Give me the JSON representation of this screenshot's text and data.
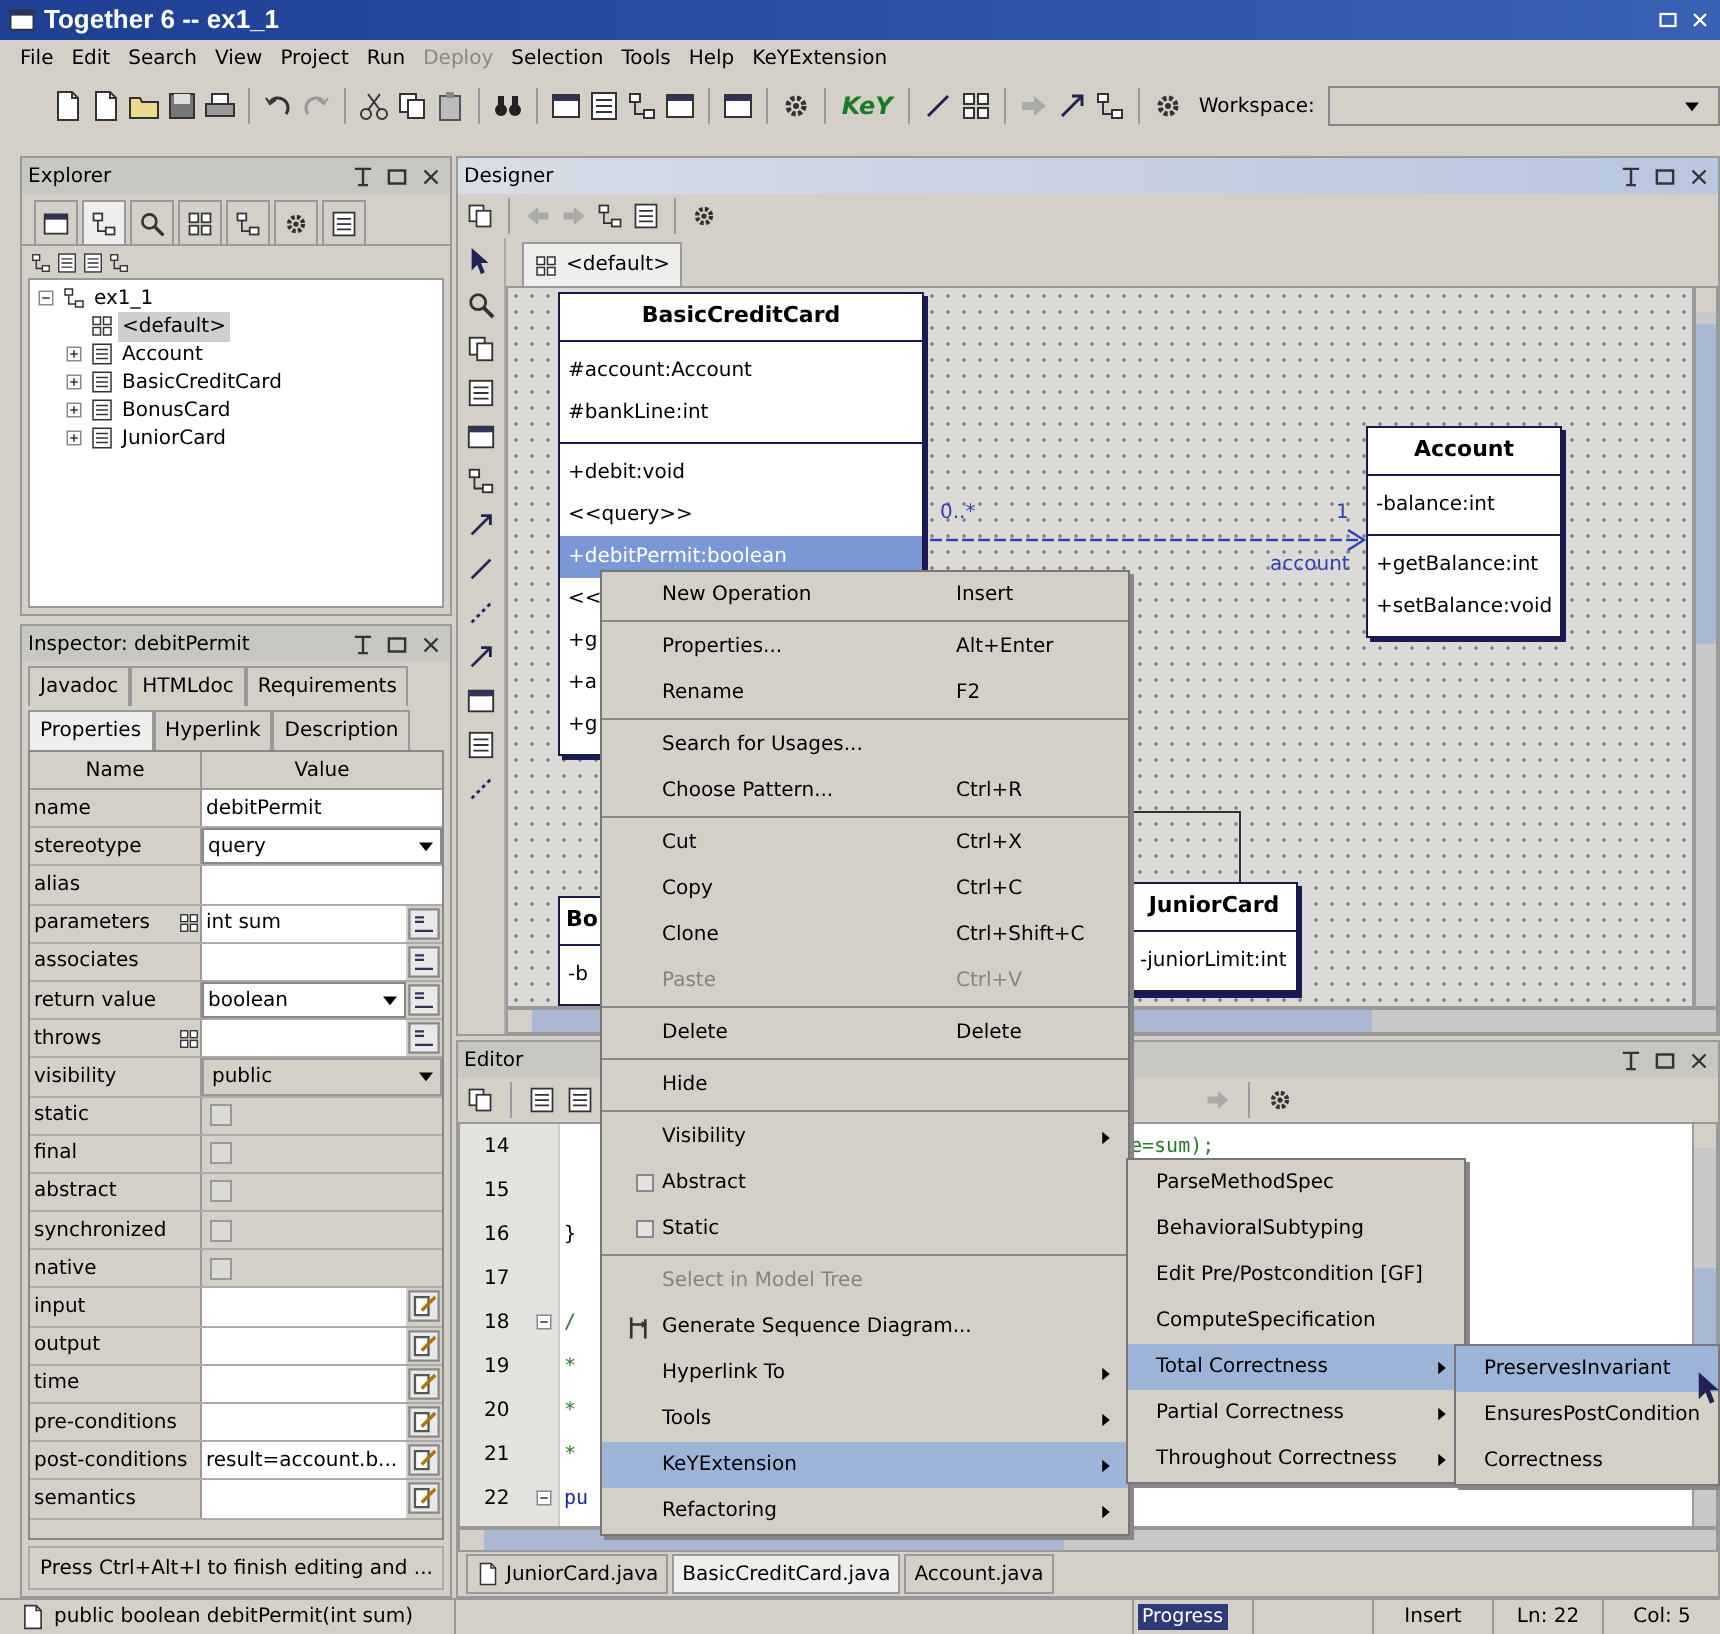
{
  "window": {
    "title": "Together 6 -- ex1_1"
  },
  "menu_bar": [
    {
      "label": "File",
      "disabled": false
    },
    {
      "label": "Edit",
      "disabled": false
    },
    {
      "label": "Search",
      "disabled": false
    },
    {
      "label": "View",
      "disabled": false
    },
    {
      "label": "Project",
      "disabled": false
    },
    {
      "label": "Run",
      "disabled": false
    },
    {
      "label": "Deploy",
      "disabled": true
    },
    {
      "label": "Selection",
      "disabled": false
    },
    {
      "label": "Tools",
      "disabled": false
    },
    {
      "label": "Help",
      "disabled": false
    },
    {
      "label": "KeYExtension",
      "disabled": false
    }
  ],
  "toolbar": {
    "key_logo": "KeY",
    "workspace_label": "Workspace:"
  },
  "explorer": {
    "title": "Explorer",
    "tabs": [
      {
        "selected": false
      },
      {
        "selected": true
      },
      {
        "selected": false
      },
      {
        "selected": false
      },
      {
        "selected": false
      },
      {
        "selected": false
      },
      {
        "selected": false
      }
    ],
    "tree": [
      {
        "label": "ex1_1",
        "kind": "project",
        "expanded": true,
        "selected": false,
        "children": [
          {
            "label": "<default>",
            "kind": "package",
            "selected": true
          },
          {
            "label": "Account",
            "kind": "class",
            "expanded": false,
            "selected": false
          },
          {
            "label": "BasicCreditCard",
            "kind": "class",
            "expanded": false,
            "selected": false
          },
          {
            "label": "BonusCard",
            "kind": "class",
            "expanded": false,
            "selected": false
          },
          {
            "label": "JuniorCard",
            "kind": "class",
            "expanded": false,
            "selected": false
          }
        ]
      }
    ]
  },
  "inspector": {
    "title": "Inspector: debitPermit",
    "tab_rows": [
      [
        {
          "label": "Javadoc",
          "selected": false
        },
        {
          "label": "HTMLdoc",
          "selected": false
        },
        {
          "label": "Requirements",
          "selected": false
        }
      ],
      [
        {
          "label": "Properties",
          "selected": true
        },
        {
          "label": "Hyperlink",
          "selected": false
        },
        {
          "label": "Description",
          "selected": false
        }
      ]
    ],
    "columns": [
      "Name",
      "Value"
    ],
    "rows": [
      {
        "name": "name",
        "kind": "text",
        "value": "debitPermit"
      },
      {
        "name": "stereotype",
        "kind": "combo",
        "value": "query"
      },
      {
        "name": "alias",
        "kind": "text"
      },
      {
        "name": "parameters",
        "kind": "list",
        "value": "int sum"
      },
      {
        "name": "associates",
        "kind": "browse"
      },
      {
        "name": "return value",
        "kind": "combo-browse",
        "value": "boolean"
      },
      {
        "name": "throws",
        "kind": "list"
      },
      {
        "name": "visibility",
        "kind": "select",
        "value": "public"
      },
      {
        "name": "static",
        "kind": "checkbox",
        "checked": false
      },
      {
        "name": "final",
        "kind": "checkbox",
        "checked": false
      },
      {
        "name": "abstract",
        "kind": "checkbox",
        "checked": false
      },
      {
        "name": "synchronized",
        "kind": "checkbox",
        "checked": false
      },
      {
        "name": "native",
        "kind": "checkbox",
        "checked": false
      },
      {
        "name": "input",
        "kind": "memo"
      },
      {
        "name": "output",
        "kind": "memo"
      },
      {
        "name": "time",
        "kind": "memo"
      },
      {
        "name": "pre-conditions",
        "kind": "memo"
      },
      {
        "name": "post-conditions",
        "kind": "memo",
        "value": "result=account.b..."
      },
      {
        "name": "semantics",
        "kind": "memo"
      }
    ],
    "hint": "Press Ctrl+Alt+I to finish editing and ..."
  },
  "designer": {
    "title": "Designer",
    "tab": "<default>",
    "classes": [
      {
        "name": "BasicCreditCard",
        "attributes": [
          {
            "text": "#account:Account",
            "selected": false
          },
          {
            "text": "#bankLine:int",
            "selected": false
          }
        ],
        "operations": [
          {
            "text": "+debit:void",
            "selected": false
          },
          {
            "text": "<<query>>",
            "selected": false
          },
          {
            "text": "+debitPermit:boolean",
            "selected": true
          },
          {
            "text": "<<",
            "selected": false
          },
          {
            "text": "+g",
            "selected": false
          },
          {
            "text": "+a",
            "selected": false
          },
          {
            "text": "+g",
            "selected": false
          }
        ]
      },
      {
        "name": "Account",
        "attributes": [
          {
            "text": "-balance:int",
            "selected": false
          }
        ],
        "operations": [
          {
            "text": "+getBalance:int",
            "selected": false
          },
          {
            "text": "+setBalance:void",
            "selected": false
          }
        ]
      },
      {
        "name": "Bo",
        "attributes": [
          {
            "text": "-b",
            "selected": false
          }
        ]
      },
      {
        "name": "JuniorCard",
        "attributes": [
          {
            "text": "-juniorLimit:int",
            "selected": false
          }
        ]
      }
    ],
    "association": {
      "source_multiplicity": "0..*",
      "target_multiplicity": "1",
      "role": "account"
    }
  },
  "editor": {
    "title": "Editor",
    "lines": [
      {
        "number": "14",
        "kind": "right",
        "text": "e=sum);",
        "fold": false
      },
      {
        "number": "15",
        "fold": false
      },
      {
        "number": "16",
        "kind": "left",
        "text": "}",
        "fold": false
      },
      {
        "number": "17",
        "fold": false
      },
      {
        "number": "18",
        "kind": "left",
        "text": "/",
        "fold": true
      },
      {
        "number": "19",
        "kind": "left",
        "text": "*",
        "fold": false
      },
      {
        "number": "20",
        "kind": "left",
        "text": "*",
        "fold": false
      },
      {
        "number": "21",
        "kind": "left",
        "text": "*",
        "fold": false
      },
      {
        "number": "22",
        "kind": "left",
        "text": "pu",
        "fold": true
      }
    ],
    "tabs": [
      {
        "label": "JuniorCard.java",
        "selected": false
      },
      {
        "label": "BasicCreditCard.java",
        "selected": true
      },
      {
        "label": "Account.java",
        "selected": false
      }
    ]
  },
  "context_menu": [
    {
      "kind": "item",
      "label": "New Operation",
      "shortcut": "Insert",
      "disabled": false,
      "selected": false
    },
    {
      "kind": "separator"
    },
    {
      "kind": "item",
      "label": "Properties...",
      "shortcut": "Alt+Enter",
      "disabled": false,
      "selected": false
    },
    {
      "kind": "item",
      "label": "Rename",
      "shortcut": "F2",
      "disabled": false,
      "selected": false
    },
    {
      "kind": "separator"
    },
    {
      "kind": "item",
      "label": "Search for Usages...",
      "disabled": false,
      "selected": false
    },
    {
      "kind": "item",
      "label": "Choose Pattern...",
      "shortcut": "Ctrl+R",
      "disabled": false,
      "selected": false
    },
    {
      "kind": "separator"
    },
    {
      "kind": "item",
      "label": "Cut",
      "shortcut": "Ctrl+X",
      "disabled": false,
      "selected": false
    },
    {
      "kind": "item",
      "label": "Copy",
      "shortcut": "Ctrl+C",
      "disabled": false,
      "selected": false
    },
    {
      "kind": "item",
      "label": "Clone",
      "shortcut": "Ctrl+Shift+C",
      "disabled": false,
      "selected": false
    },
    {
      "kind": "item",
      "label": "Paste",
      "shortcut": "Ctrl+V",
      "disabled": true,
      "selected": false
    },
    {
      "kind": "separator"
    },
    {
      "kind": "item",
      "label": "Delete",
      "shortcut": "Delete",
      "disabled": false,
      "selected": false
    },
    {
      "kind": "separator"
    },
    {
      "kind": "item",
      "label": "Hide",
      "disabled": false,
      "selected": false
    },
    {
      "kind": "separator"
    },
    {
      "kind": "submenu",
      "label": "Visibility",
      "disabled": false,
      "selected": false
    },
    {
      "kind": "check",
      "label": "Abstract",
      "checked": false,
      "disabled": false,
      "selected": false
    },
    {
      "kind": "check",
      "label": "Static",
      "checked": false,
      "disabled": false,
      "selected": false
    },
    {
      "kind": "separator"
    },
    {
      "kind": "item",
      "label": "Select in Model Tree",
      "disabled": true,
      "selected": false
    },
    {
      "kind": "icon-item",
      "label": "Generate Sequence Diagram...",
      "disabled": false,
      "selected": false
    },
    {
      "kind": "submenu",
      "label": "Hyperlink To",
      "disabled": false,
      "selected": false
    },
    {
      "kind": "submenu",
      "label": "Tools",
      "disabled": false,
      "selected": false
    },
    {
      "kind": "submenu",
      "label": "KeYExtension",
      "disabled": false,
      "selected": true
    },
    {
      "kind": "submenu",
      "label": "Refactoring",
      "disabled": false,
      "selected": false
    }
  ],
  "submenu": [
    {
      "kind": "item",
      "label": "ParseMethodSpec",
      "selected": false
    },
    {
      "kind": "item",
      "label": "BehavioralSubtyping",
      "selected": false
    },
    {
      "kind": "item",
      "label": "Edit Pre/Postcondition [GF]",
      "selected": false
    },
    {
      "kind": "item",
      "label": "ComputeSpecification",
      "selected": false
    },
    {
      "kind": "submenu",
      "label": "Total Correctness",
      "selected": true
    },
    {
      "kind": "submenu",
      "label": "Partial Correctness",
      "selected": false
    },
    {
      "kind": "submenu",
      "label": "Throughout Correctness",
      "selected": false
    }
  ],
  "submenu_2": [
    {
      "kind": "item",
      "label": "PreservesInvariant",
      "selected": true
    },
    {
      "kind": "item",
      "label": "EnsuresPostCondition",
      "selected": false
    },
    {
      "kind": "item",
      "label": "Correctness",
      "selected": false
    }
  ],
  "status_bar": {
    "message": "public boolean debitPermit(int sum)",
    "progress": "Progress",
    "mode": "Insert",
    "line": "Ln: 22",
    "column": "Col: 5"
  }
}
